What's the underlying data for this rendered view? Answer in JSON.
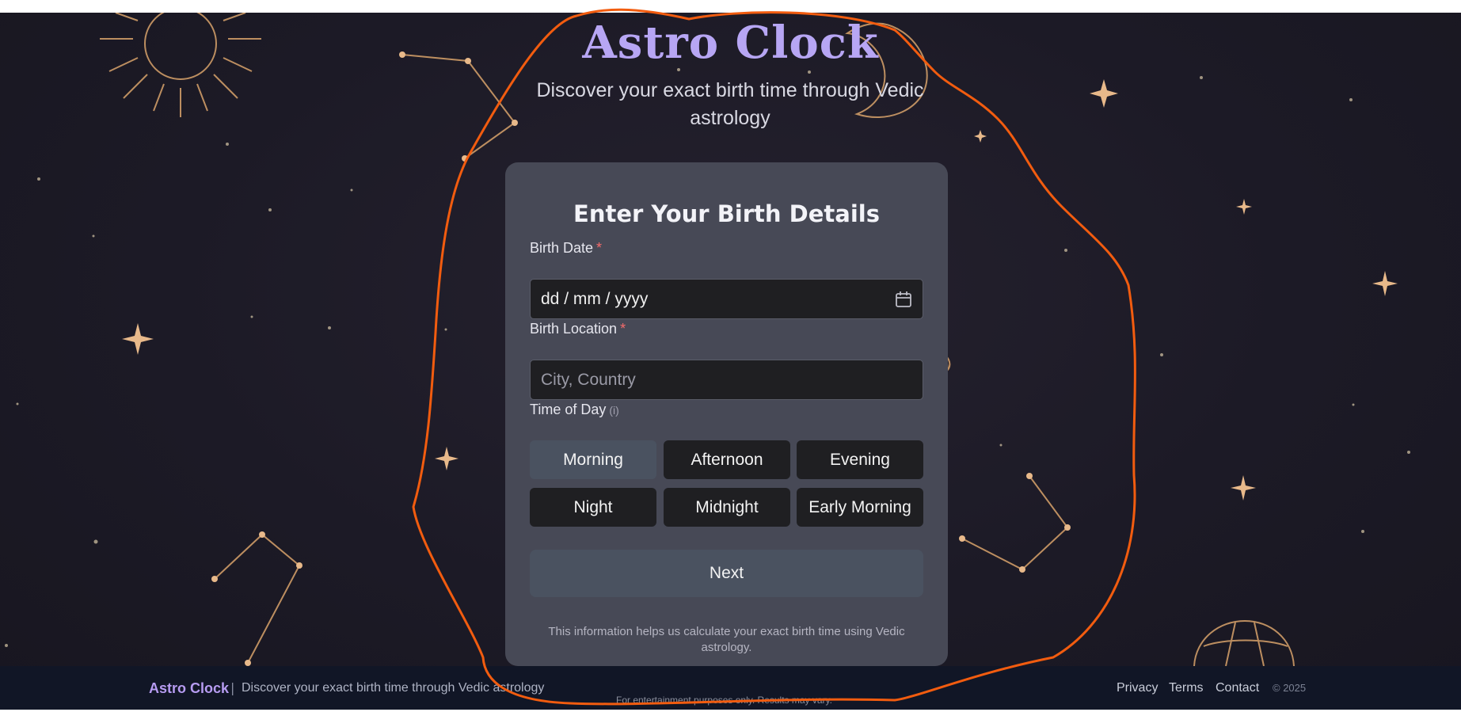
{
  "app": {
    "title": "Astro Clock",
    "subtitle": "Discover your exact birth time through Vedic astrology"
  },
  "form": {
    "heading": "Enter Your Birth Details",
    "birth_date": {
      "label": "Birth Date",
      "required_mark": "*",
      "value": "dd / mm / yyyy"
    },
    "birth_location": {
      "label": "Birth Location",
      "required_mark": "*",
      "placeholder": "City, Country"
    },
    "time_of_day": {
      "label": "Time of Day",
      "info": "(i)",
      "selected": "Morning",
      "options": [
        "Morning",
        "Afternoon",
        "Evening",
        "Night",
        "Midnight",
        "Early Morning"
      ]
    },
    "next_label": "Next",
    "note": "This information helps us calculate your exact birth time using Vedic astrology."
  },
  "footer": {
    "brand": "Astro Clock",
    "separator": "|",
    "tagline": "Discover your exact birth time through Vedic astrology",
    "links": [
      "Privacy",
      "Terms",
      "Contact"
    ],
    "copyright": "© 2025",
    "disclaimer_partial": "For entertainment purposes only. Results may vary."
  },
  "colors": {
    "background": "#1c1a26",
    "card": "#474956",
    "accent_title": "#b7a6f4",
    "gold_art": "#d9a36b",
    "selected_option": "#4a5260",
    "annotation": "#f25c0f"
  },
  "icons": [
    "calendar-icon",
    "sun-icon",
    "moon-icon",
    "star-icon",
    "constellation-icon",
    "planet-icon"
  ]
}
